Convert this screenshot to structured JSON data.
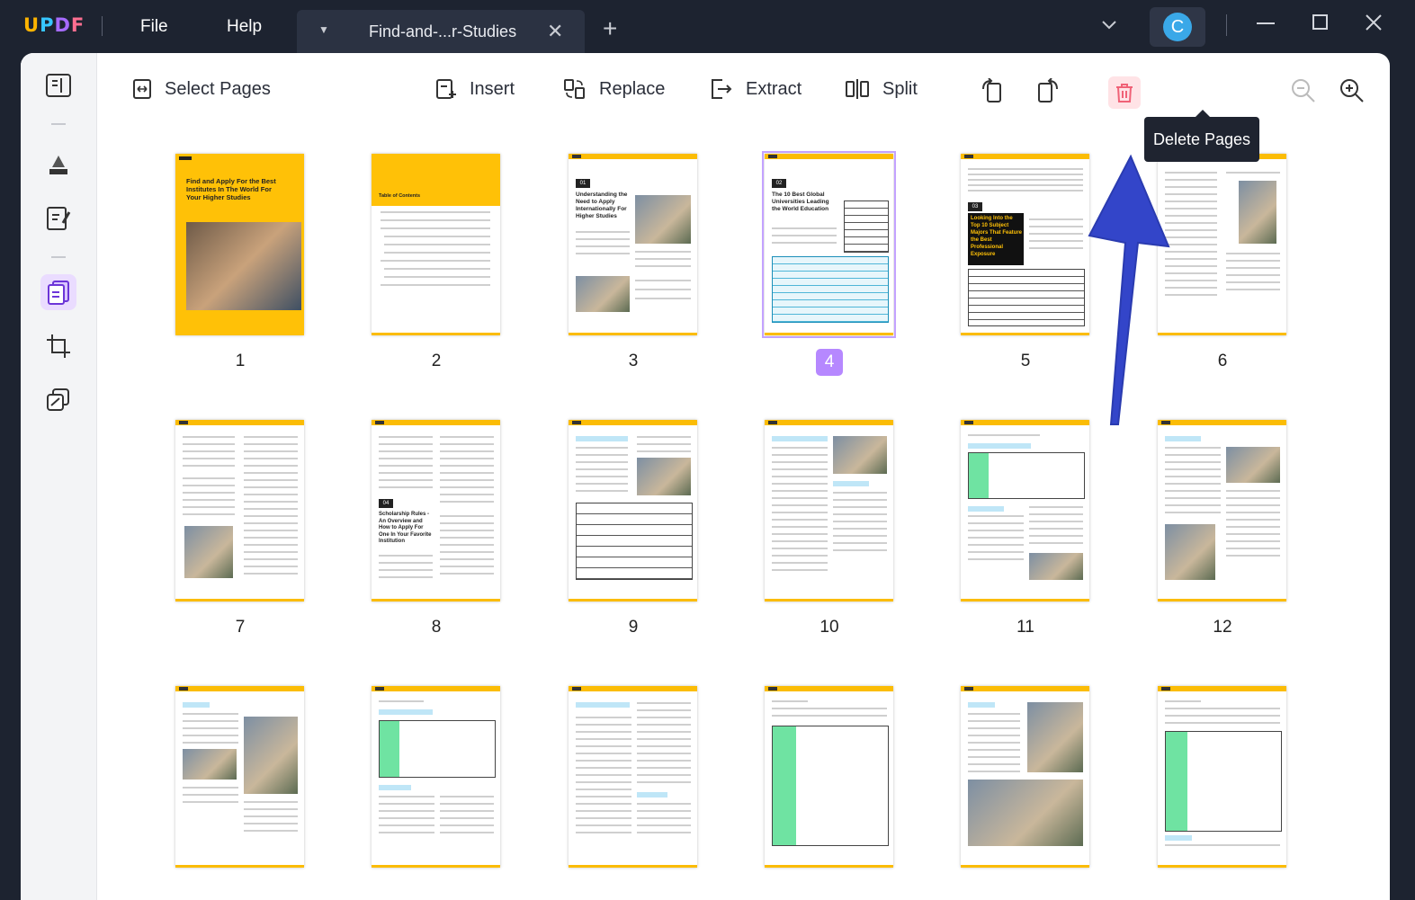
{
  "titlebar": {
    "logo": {
      "u": "U",
      "p": "P",
      "d": "D",
      "f": "F"
    },
    "menu": [
      "File",
      "Help"
    ],
    "tab_title": "Find-and-...r-Studies",
    "avatar_letter": "C"
  },
  "toolbar": {
    "select_pages": "Select Pages",
    "insert": "Insert",
    "replace": "Replace",
    "extract": "Extract",
    "split": "Split",
    "tooltip": "Delete Pages"
  },
  "pages": [
    {
      "number": "1",
      "selected": false
    },
    {
      "number": "2",
      "selected": false
    },
    {
      "number": "3",
      "selected": false
    },
    {
      "number": "4",
      "selected": true
    },
    {
      "number": "5",
      "selected": false
    },
    {
      "number": "6",
      "selected": false
    },
    {
      "number": "7",
      "selected": false
    },
    {
      "number": "8",
      "selected": false
    },
    {
      "number": "9",
      "selected": false
    },
    {
      "number": "10",
      "selected": false
    },
    {
      "number": "11",
      "selected": false
    },
    {
      "number": "12",
      "selected": false
    },
    {
      "number": "",
      "selected": false
    },
    {
      "number": "",
      "selected": false
    },
    {
      "number": "",
      "selected": false
    },
    {
      "number": "",
      "selected": false
    },
    {
      "number": "",
      "selected": false
    },
    {
      "number": "",
      "selected": false
    }
  ],
  "page_content": {
    "p1_title": "Find and Apply For the Best Institutes In The World For Your Higher Studies",
    "p2_title": "Table of Contents",
    "p3_badge": "01",
    "p3_title": "Understanding the Need to Apply Internationally For Higher Studies",
    "p4_badge": "02",
    "p4_title": "The 10 Best Global Universities Leading the World Education",
    "p5_badge": "03",
    "p5_title": "Looking Into the Top 10 Subject Majors That Feature the Best Professional Exposure",
    "p8_badge": "04",
    "p8_title": "Scholarship Rules - An Overview and How to Apply For One In Your Favorite Institution"
  },
  "colors": {
    "accent": "#fbbc05",
    "selected": "#b688ff",
    "delete_bg": "#ffe3e6",
    "delete_icon": "#f06277",
    "arrow": "#3345c9"
  }
}
